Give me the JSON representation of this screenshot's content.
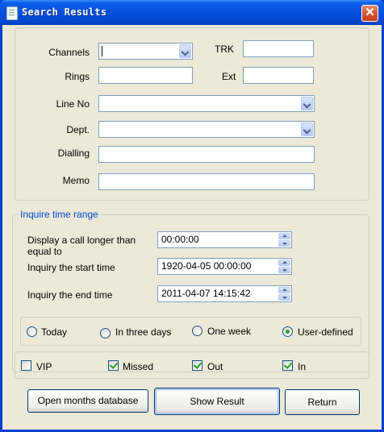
{
  "window": {
    "title": "Search Results",
    "close_glyph": "✕"
  },
  "filters": {
    "channels_label": "Channels",
    "channels_value": "",
    "trk_label": "TRK",
    "trk_value": "",
    "rings_label": "Rings",
    "rings_value": "",
    "ext_label": "Ext",
    "ext_value": "",
    "line_no_label": "Line No",
    "line_no_value": "",
    "dept_label": "Dept.",
    "dept_value": "",
    "dialling_label": "Dialling",
    "dialling_value": "",
    "memo_label": "Memo",
    "memo_value": ""
  },
  "time_range": {
    "legend": "Inquire time range",
    "longer_than_label": "Display a call longer than equal to",
    "longer_than_value": "00:00:00",
    "start_label": "Inquiry the start time",
    "start_value": "1920-04-05 00:00:00",
    "end_label": "Inquiry the end time",
    "end_value": "2011-04-07 14:15:42",
    "options": [
      {
        "label": "Today",
        "selected": false
      },
      {
        "label": "In three days",
        "selected": false
      },
      {
        "label": "One week",
        "selected": false
      },
      {
        "label": "User-defined",
        "selected": true
      }
    ]
  },
  "call_types": [
    {
      "label": "VIP",
      "checked": false
    },
    {
      "label": "Missed",
      "checked": true
    },
    {
      "label": "Out",
      "checked": true
    },
    {
      "label": "In",
      "checked": true
    }
  ],
  "buttons": {
    "open_months": "Open months database",
    "show_result": "Show Result",
    "return": "Return"
  },
  "colors": {
    "title_bar": "#0551e0",
    "legend_text": "#0046d5",
    "check_mark": "#21a121",
    "window_bg": "#ece9d8"
  },
  "icons": {
    "title": "document-icon",
    "close": "close-icon"
  }
}
